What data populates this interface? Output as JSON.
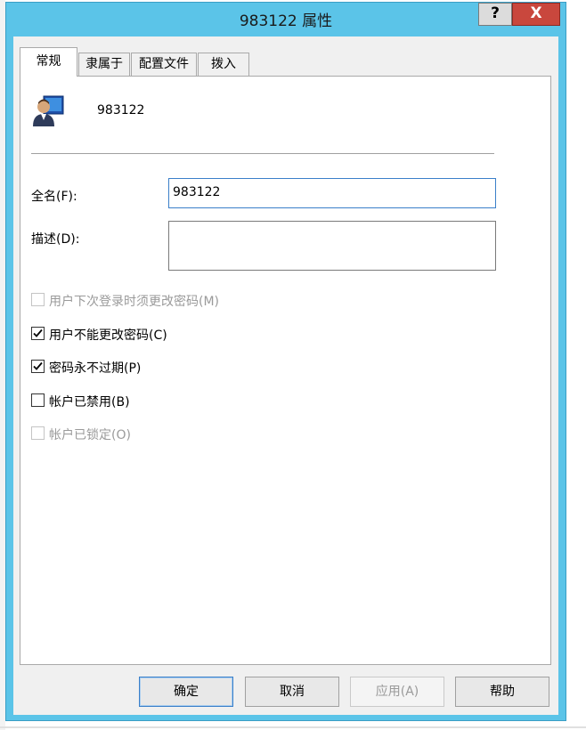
{
  "window": {
    "title": "983122 属性",
    "help_label": "?",
    "close_label": "X"
  },
  "tabs": [
    {
      "label": "常规",
      "active": true
    },
    {
      "label": "隶属于",
      "active": false
    },
    {
      "label": "配置文件",
      "active": false
    },
    {
      "label": "拨入",
      "active": false
    }
  ],
  "user": {
    "name": "983122",
    "icon": "user-computer-icon"
  },
  "fields": {
    "fullname": {
      "label": "全名(F):",
      "value": "983122"
    },
    "description": {
      "label": "描述(D):",
      "value": ""
    }
  },
  "checkboxes": [
    {
      "label": "用户下次登录时须更改密码(M)",
      "checked": false,
      "disabled": true
    },
    {
      "label": "用户不能更改密码(C)",
      "checked": true,
      "disabled": false
    },
    {
      "label": "密码永不过期(P)",
      "checked": true,
      "disabled": false
    },
    {
      "label": "帐户已禁用(B)",
      "checked": false,
      "disabled": false
    },
    {
      "label": "帐户已锁定(O)",
      "checked": false,
      "disabled": true
    }
  ],
  "buttons": {
    "ok": "确定",
    "cancel": "取消",
    "apply": "应用(A)",
    "help": "帮助"
  },
  "colors": {
    "titlebar": "#5bc4e8",
    "close": "#c9473d",
    "accent": "#3a7fc9"
  }
}
